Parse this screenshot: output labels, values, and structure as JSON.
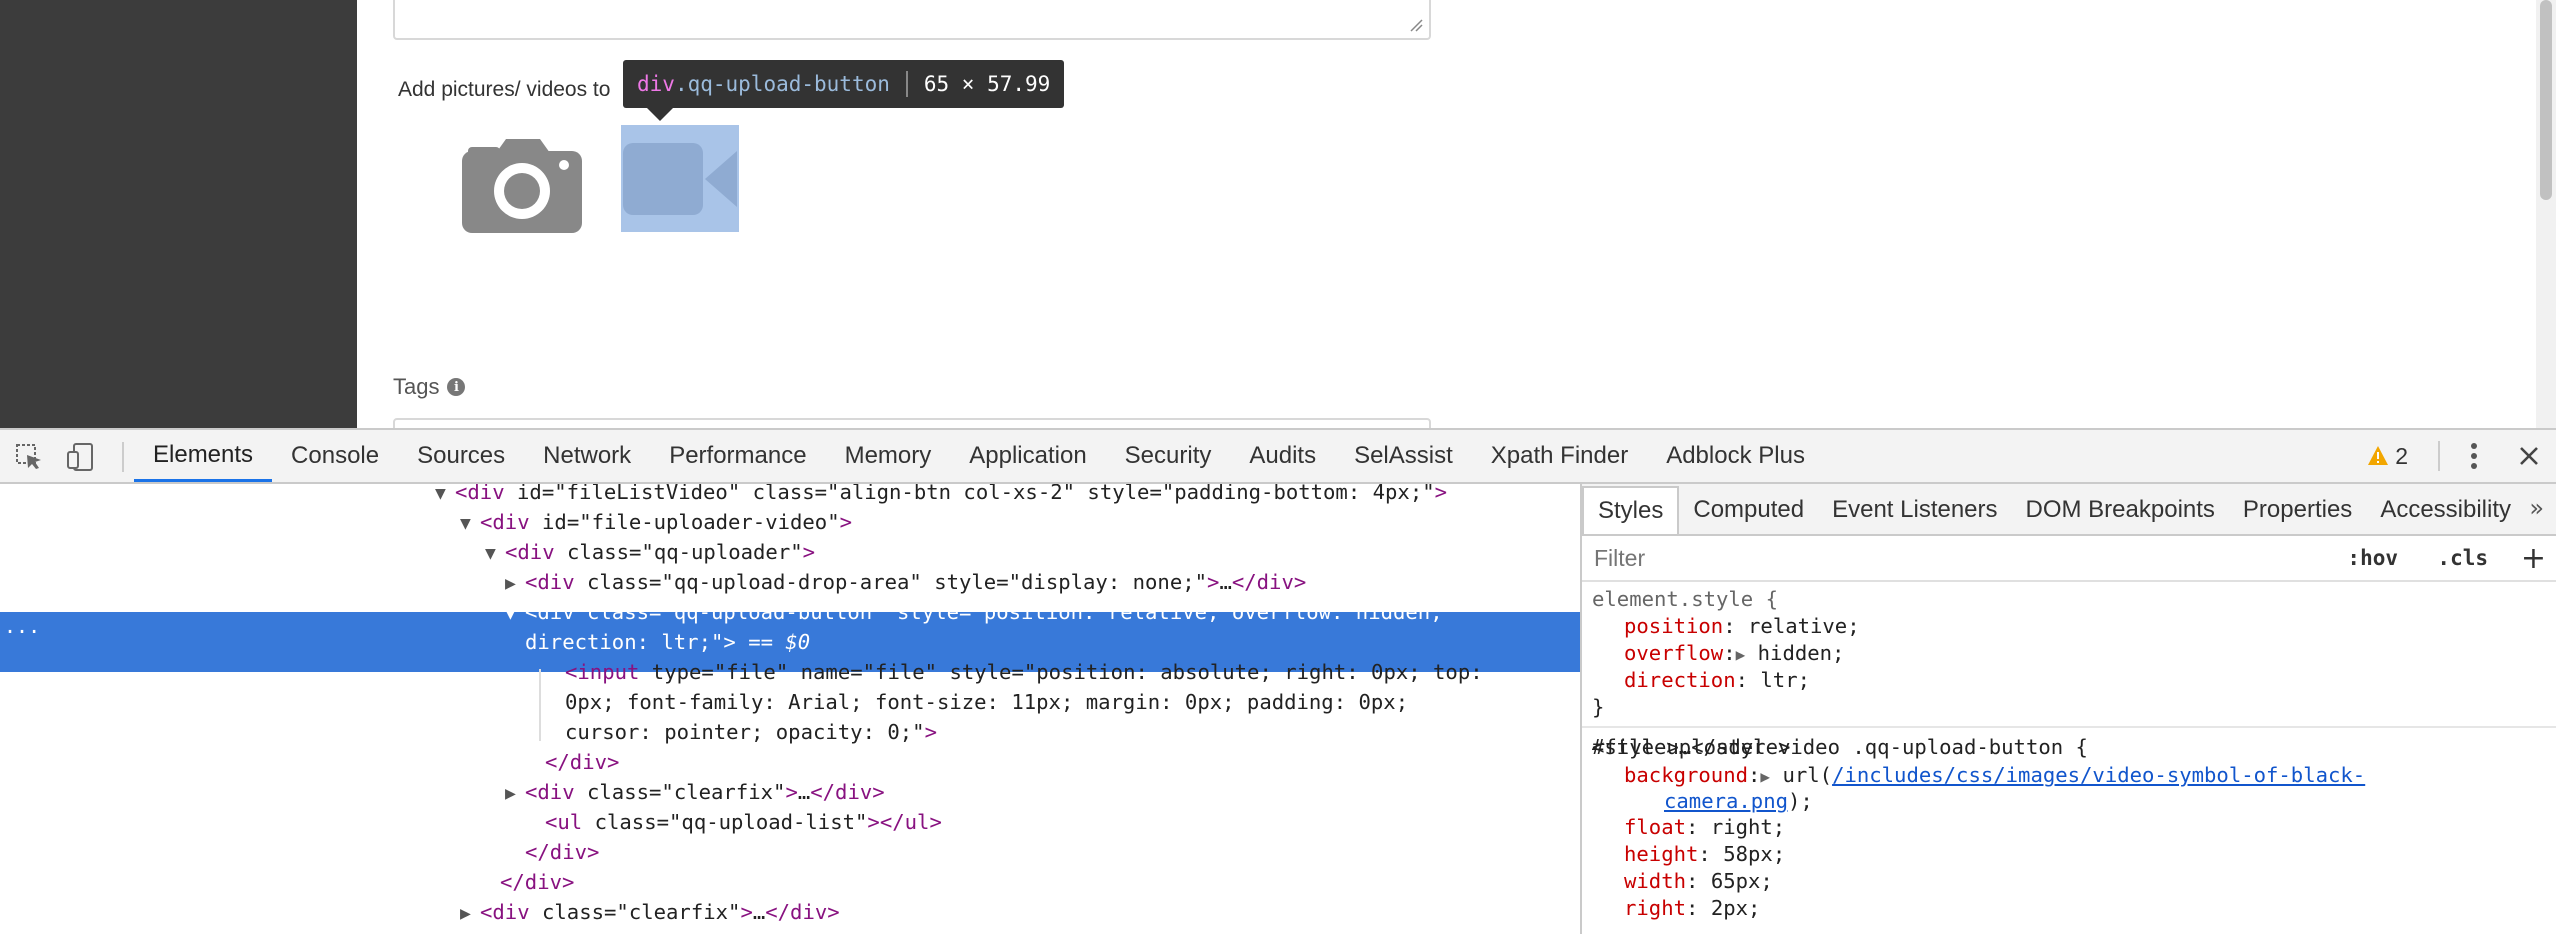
{
  "page": {
    "add_media_label": "Add pictures/ videos to",
    "tags_label": "Tags",
    "tooltip": {
      "tag": "div",
      "class": ".qq-upload-button",
      "size": "65 × 57.99"
    }
  },
  "devtools": {
    "tabs": [
      "Elements",
      "Console",
      "Sources",
      "Network",
      "Performance",
      "Memory",
      "Application",
      "Security",
      "Audits",
      "SelAssist",
      "Xpath Finder",
      "Adblock Plus"
    ],
    "active_tab": "Elements",
    "warning_count": "2",
    "elements": {
      "lines": [
        {
          "tri": "▼",
          "html": "<div id=\"fileListVideo\" class=\"align-btn col-xs-2\" style=\"padding-bottom: 4px;\">"
        },
        {
          "tri": "▼",
          "html": "<div id=\"file-uploader-video\">"
        },
        {
          "tri": "▼",
          "html": "<div class=\"qq-uploader\">"
        },
        {
          "tri": "▶",
          "html": "<div class=\"qq-upload-drop-area\" style=\"display: none;\">…</div>"
        },
        {
          "tri": "▼",
          "html": "<div class=\"qq-upload-button\" style=\"position: relative; overflow: hidden;"
        },
        {
          "tri": "",
          "html": "direction: ltr;\"> == $0"
        },
        {
          "tri": "",
          "html": "<input type=\"file\" name=\"file\" style=\"position: absolute; right: 0px; top:"
        },
        {
          "tri": "",
          "html": "0px; font-family: Arial; font-size: 11px; margin: 0px; padding: 0px;"
        },
        {
          "tri": "",
          "html": "cursor: pointer; opacity: 0;\">"
        },
        {
          "tri": "",
          "html": "</div>"
        },
        {
          "tri": "▶",
          "html": "<div class=\"clearfix\">…</div>"
        },
        {
          "tri": "",
          "html": "<ul class=\"qq-upload-list\"></ul>"
        },
        {
          "tri": "",
          "html": "</div>"
        },
        {
          "tri": "",
          "html": "</div>"
        },
        {
          "tri": "▶",
          "html": "<div class=\"clearfix\">…</div>"
        }
      ],
      "selected_dots": "..."
    },
    "sidebar": {
      "tabs": [
        "Styles",
        "Computed",
        "Event Listeners",
        "DOM Breakpoints",
        "Properties",
        "Accessibility"
      ],
      "active_tab": "Styles",
      "more": "»",
      "filter_placeholder": "Filter",
      "hov": ":hov",
      "cls": ".cls",
      "add": "+",
      "element_style": {
        "selector": "element.style {",
        "props": [
          {
            "name": "position",
            "value": "relative;"
          },
          {
            "name": "overflow",
            "value": "hidden;"
          },
          {
            "name": "direction",
            "value": "ltr;"
          }
        ],
        "close": "}"
      },
      "rule2": {
        "selector": "#file-uploader-video .qq-upload-button {",
        "source": "<style>…</style>",
        "background_name": "background",
        "background_pre": "url(",
        "background_link1": "/includes/css/images/video-symbol-of-black-",
        "background_link2": "camera.png",
        "background_post": ");",
        "props": [
          {
            "name": "float",
            "value": "right;"
          },
          {
            "name": "height",
            "value": "58px;"
          },
          {
            "name": "width",
            "value": "65px;"
          },
          {
            "name": "right",
            "value": "2px;"
          }
        ]
      }
    }
  }
}
